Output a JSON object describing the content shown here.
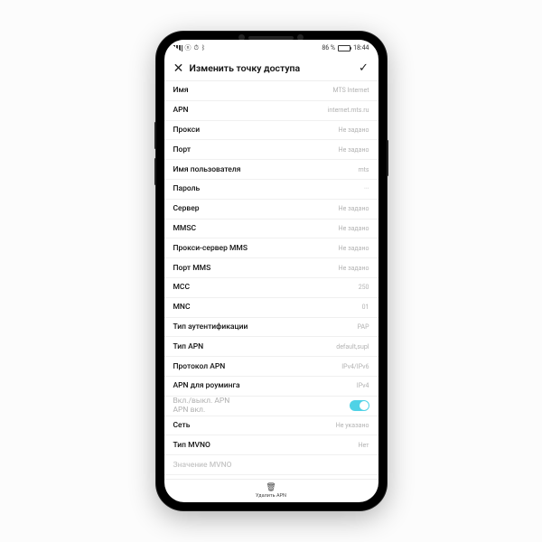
{
  "statusbar": {
    "battery_pct": "86 %",
    "time": "18:44"
  },
  "header": {
    "title": "Изменить точку доступа"
  },
  "rows": [
    {
      "label": "Имя",
      "value": "MTS Internet"
    },
    {
      "label": "APN",
      "value": "internet.mts.ru"
    },
    {
      "label": "Прокси",
      "value": "Не задано"
    },
    {
      "label": "Порт",
      "value": "Не задано"
    },
    {
      "label": "Имя пользователя",
      "value": "mts"
    },
    {
      "label": "Пароль",
      "value": "···"
    },
    {
      "label": "Сервер",
      "value": "Не задано"
    },
    {
      "label": "MMSC",
      "value": "Не задано"
    },
    {
      "label": "Прокси-сервер MMS",
      "value": "Не задано"
    },
    {
      "label": "Порт MMS",
      "value": "Не задано"
    },
    {
      "label": "MCC",
      "value": "250"
    },
    {
      "label": "MNC",
      "value": "01"
    },
    {
      "label": "Тип аутентификации",
      "value": "PAP"
    },
    {
      "label": "Тип APN",
      "value": "default,supl"
    },
    {
      "label": "Протокол APN",
      "value": "IPv4/IPv6"
    },
    {
      "label": "APN для роуминга",
      "value": "IPv4"
    }
  ],
  "toggle": {
    "label_line1": "Вкл./выкл. APN",
    "label_line2": "APN вкл.",
    "on": true
  },
  "rows_after": [
    {
      "label": "Сеть",
      "value": "Не указано"
    },
    {
      "label": "Тип MVNO",
      "value": "Нет"
    }
  ],
  "disabled_row": {
    "label": "Значение MVNO",
    "value": ""
  },
  "footer": {
    "label": "Удалить APN"
  }
}
